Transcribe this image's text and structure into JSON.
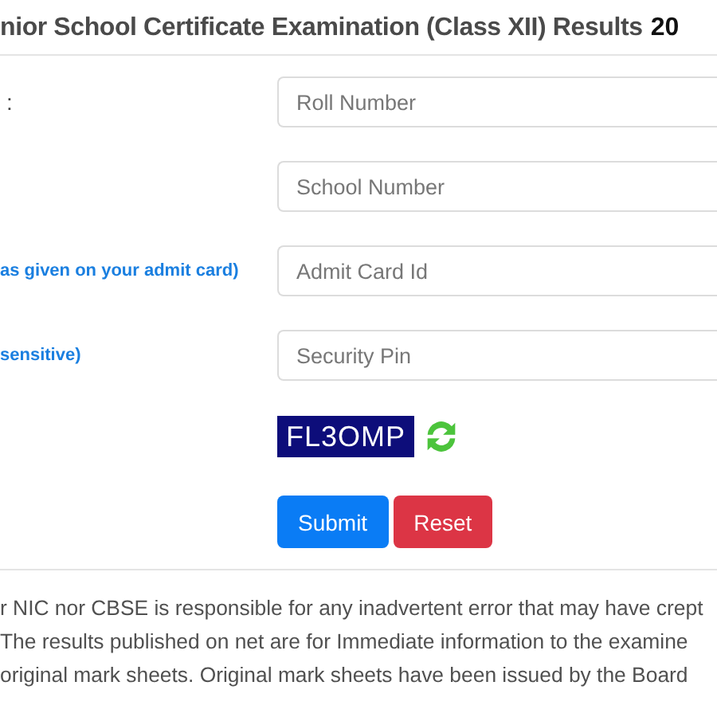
{
  "heading": {
    "title": "nior School Certificate Examination (Class XII) Results",
    "year": "20"
  },
  "fields": [
    {
      "label": ":",
      "kind": "plain",
      "placeholder": "Roll Number"
    },
    {
      "placeholder": "School Number"
    },
    {
      "label": "as given on your admit card)",
      "kind": "hint",
      "placeholder": "Admit Card Id"
    },
    {
      "label": "sensitive)",
      "kind": "hint",
      "placeholder": "Security Pin"
    }
  ],
  "captcha": {
    "code": "FL3OMP"
  },
  "buttons": [
    {
      "label": "Submit",
      "kind": "primary"
    },
    {
      "label": "Reset",
      "kind": "danger"
    }
  ],
  "disclaimer": [
    "r NIC nor CBSE is responsible for any inadvertent error that may have crept",
    "The results published on net are for Immediate information to the examine",
    "original mark sheets. Original mark sheets have been issued by the Board"
  ]
}
